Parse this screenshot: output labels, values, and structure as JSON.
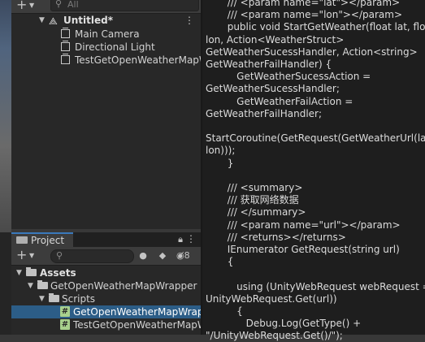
{
  "hierarchy": {
    "search_placeholder": "All",
    "scene_name": "Untitled*",
    "items": [
      {
        "label": "Main Camera"
      },
      {
        "label": "Directional Light"
      },
      {
        "label": "TestGetOpenWeatherMapW"
      }
    ]
  },
  "project": {
    "tab_label": "Project",
    "hidden_count": "8",
    "tree": [
      {
        "label": "Assets",
        "type": "folder"
      },
      {
        "label": "GetOpenWeatherMapWrapper",
        "type": "folder"
      },
      {
        "label": "Scripts",
        "type": "folder"
      },
      {
        "label": "GetOpenWeatherMapWrapp",
        "type": "script"
      },
      {
        "label": "TestGetOpenWeatherMapW",
        "type": "script"
      }
    ]
  },
  "code_lines": [
    "       /// <param name=\"lat\"></param>",
    "       /// <param name=\"lon\"></param>",
    "       public void StartGetWeather(float lat, float",
    "lon, Action<WeatherStruct>",
    "GetWeatherSucessHandler, Action<string>",
    "GetWeatherFailHandler) {",
    "          GetWeatherSucessAction =",
    "GetWeatherSucessHandler;",
    "          GetWeatherFailAction =",
    "GetWeatherFailHandler;",
    "",
    "StartCoroutine(GetRequest(GetWeatherUrl(lat,",
    "lon)));",
    "       }",
    "",
    "       /// <summary>",
    "       /// 获取网络数据",
    "       /// </summary>",
    "       /// <param name=\"url\"></param>",
    "       /// <returns></returns>",
    "       IEnumerator GetRequest(string url)",
    "       {",
    "",
    "          using (UnityWebRequest webRequest =",
    "UnityWebRequest.Get(url))",
    "          {",
    "             Debug.Log(GetType() +",
    "\"/UnityWebRequest.Get()/\");"
  ]
}
